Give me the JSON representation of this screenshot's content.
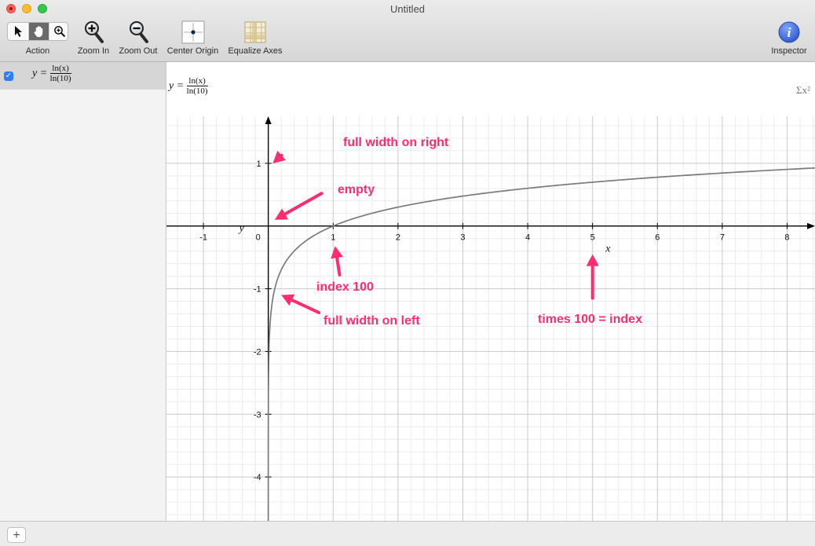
{
  "window": {
    "title": "Untitled"
  },
  "toolbar": {
    "action_label": "Action",
    "zoom_in_label": "Zoom In",
    "zoom_out_label": "Zoom Out",
    "center_origin_label": "Center Origin",
    "equalize_axes_label": "Equalize Axes",
    "inspector_label": "Inspector",
    "inspector_glyph": "i",
    "active_tool": "hand"
  },
  "sidebar": {
    "equations": [
      {
        "checked": true,
        "lhs": "y =",
        "numerator": "ln(x)",
        "denominator": "ln(10)"
      }
    ]
  },
  "editor": {
    "lhs": "y =",
    "numerator": "ln(x)",
    "denominator": "ln(10)",
    "sigma_button": "Σx²"
  },
  "chart_data": {
    "type": "line",
    "function": "y = ln(x)/ln(10)",
    "xlim": [
      -1.57,
      8.43
    ],
    "ylim": [
      -4.7,
      1.75
    ],
    "x_ticks": [
      -1,
      0,
      1,
      2,
      3,
      4,
      5,
      6,
      7,
      8
    ],
    "y_ticks": [
      1,
      -1,
      -2,
      -3,
      -4
    ],
    "xlabel": "x",
    "ylabel": "y",
    "grid": true,
    "minor_grid": true,
    "series": [
      {
        "line_color": "#7a7a7a"
      }
    ],
    "annotations": [
      {
        "text": "full width on right",
        "arrow_from": [
          0.2,
          1.12
        ],
        "arrow_to": [
          0.07,
          1.0
        ]
      },
      {
        "text": "empty",
        "arrow_from": [
          0.82,
          0.52
        ],
        "arrow_to": [
          0.1,
          0.1
        ]
      },
      {
        "text": "index 100",
        "arrow_from": [
          1.1,
          -0.78
        ],
        "arrow_to": [
          1.03,
          -0.32
        ]
      },
      {
        "text": "full width on left",
        "arrow_from": [
          0.78,
          -1.38
        ],
        "arrow_to": [
          0.2,
          -1.1
        ]
      },
      {
        "text": "times 100 = index",
        "arrow_from": [
          5.0,
          -1.15
        ],
        "arrow_to": [
          5.0,
          -0.45
        ]
      }
    ],
    "annotation_color": "#ff2d6f"
  }
}
